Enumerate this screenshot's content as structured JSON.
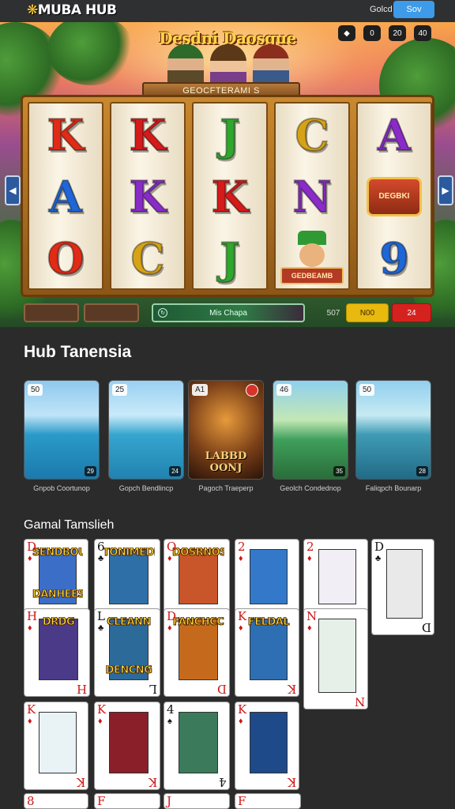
{
  "header": {
    "logo_text": "MUBA HUB",
    "gold_label": "Golcd",
    "sov_button": "Sov"
  },
  "hero": {
    "title": "Desdni Daosque",
    "subtitle": "GEOCFTERAMI S",
    "hud": [
      "",
      "0",
      "20",
      "40"
    ],
    "reels": [
      [
        {
          "t": "K",
          "c": "#e02b16"
        },
        {
          "t": "A",
          "c": "#1f66d6"
        },
        {
          "t": "O",
          "c": "#e02b16"
        }
      ],
      [
        {
          "t": "K",
          "c": "#d61a1a"
        },
        {
          "t": "K",
          "c": "#8a2bc9"
        },
        {
          "t": "C",
          "c": "#d6a316"
        }
      ],
      [
        {
          "t": "J",
          "c": "#2ea82c"
        },
        {
          "t": "K",
          "c": "#d61a1a"
        },
        {
          "t": "J",
          "c": "#2ea82c"
        }
      ],
      [
        {
          "t": "C",
          "c": "#d6a316"
        },
        {
          "t": "N",
          "c": "#8a2bc9"
        },
        {
          "t": "",
          "c": "#2ea82c"
        }
      ],
      [
        {
          "t": "A",
          "c": "#8a2bc9"
        },
        {
          "t": "",
          "c": "#c0392b"
        },
        {
          "t": "9",
          "c": "#1f66d6"
        }
      ]
    ],
    "badge_text": "DEGBKI",
    "face_banner": "GEDBEAMB"
  },
  "controls": {
    "center_label": "Mis Chapa",
    "num": "507",
    "yellow": "N00",
    "red": "24"
  },
  "hub": {
    "title": "Hub Tanensia",
    "cards": [
      {
        "num": "50",
        "corner": "29",
        "caption": "Gnpob Coortunop",
        "bg": "linear-gradient(#8fc9ef 0%, #bfe4f7 35%, #2a9ac9 55%, #1b7aab 100%)"
      },
      {
        "num": "25",
        "corner": "24",
        "caption": "Gopch Bendlincp",
        "bg": "linear-gradient(#9ad0f2 0%, #c9eaf9 35%, #36a5cf 55%, #2182b0 100%)"
      },
      {
        "num": "A1",
        "corner": "",
        "caption": "Pagoch Traeperp",
        "bg": "radial-gradient(circle at 50% 40%, #e79a3b 0%, #7a3f18 55%, #2a1408 100%)",
        "art_text": "LABBD OONJ",
        "red_dot": true
      },
      {
        "num": "46",
        "corner": "35",
        "caption": "Geolch Condednop",
        "bg": "linear-gradient(#8fd0ee 0%, #c3e7b5 40%, #3f9f5b 60%, #2a6d3a 100%)"
      },
      {
        "num": "50",
        "corner": "28",
        "caption": "Faliqpch Bounarp",
        "bg": "linear-gradient(#91cfee 0%, #c6eaf3 35%, #3f9bb5 55%, #216b86 100%)"
      }
    ]
  },
  "gamal": {
    "title": "Gamal Tamslieh",
    "cards": [
      {
        "rank": "D",
        "suit": "♦",
        "color": "red",
        "art_text": "SENDBOUN",
        "art_text2": "DANHEES",
        "bg": "#3b6fc7"
      },
      {
        "rank": "6",
        "suit": "♣",
        "color": "black",
        "art_text": "TONIMEDI",
        "bg": "#2f6fa8"
      },
      {
        "rank": "O",
        "suit": "♦",
        "color": "red",
        "art_text": "DOSRNOS",
        "bg": "#c9552a"
      },
      {
        "rank": "2",
        "suit": "♦",
        "color": "red",
        "art_text": "",
        "bg": "#3478c9"
      },
      {
        "rank": "2",
        "suit": "♦",
        "color": "red",
        "art_text": "",
        "bg": "#f2eef5"
      },
      {
        "rank": "D",
        "suit": "♣",
        "color": "black",
        "art_text": "",
        "bg": "#e9e9e9"
      },
      {
        "rank": "H",
        "suit": "♦",
        "color": "red",
        "art_text": "DRDG",
        "bg": "#4a3a88"
      },
      {
        "rank": "L",
        "suit": "♣",
        "color": "black",
        "art_text": "CLEANN",
        "art_text2": "DENCNG",
        "bg": "#2c6a9a"
      },
      {
        "rank": "D",
        "suit": "♦",
        "color": "red",
        "art_text": "FANCHCC",
        "bg": "#c56a1c"
      },
      {
        "rank": "K",
        "suit": "♦",
        "color": "red",
        "art_text": "FELDAL",
        "bg": "#2d6fb2"
      },
      {
        "rank": "N",
        "suit": "♦",
        "color": "red",
        "art_text": "",
        "bg": "#e7efe9"
      },
      {
        "rank": "K",
        "suit": "♦",
        "color": "red",
        "art_text": "",
        "bg": "#e9f3f6"
      },
      {
        "rank": "K",
        "suit": "♦",
        "color": "red",
        "art_text": "",
        "bg": "#8a1f2a"
      },
      {
        "rank": "4",
        "suit": "♠",
        "color": "black",
        "art_text": "",
        "bg": "#3b7a5a"
      },
      {
        "rank": "K",
        "suit": "♦",
        "color": "red",
        "art_text": "",
        "bg": "#1f4a8a"
      }
    ],
    "bottom_ranks": [
      "8",
      "F",
      "J",
      "F"
    ]
  }
}
